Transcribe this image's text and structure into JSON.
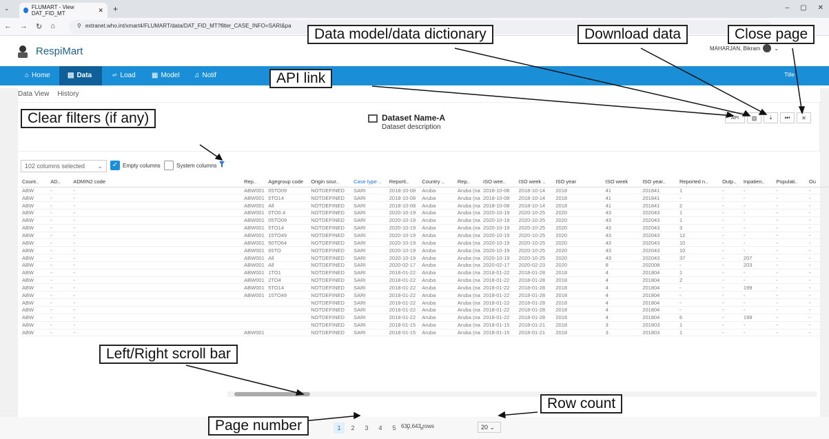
{
  "browser": {
    "tab_title": "FLUMART - View DAT_FID_MT",
    "url": "extranet.who.int/xmart4/FLUMART/data/DAT_FID_MT?filter_CASE_INFO=SARI&pa"
  },
  "app": {
    "name": "RespiMart",
    "user": "MAHARJAN, Bikram",
    "nav": [
      "Home",
      "Data",
      "Load",
      "Model",
      "Notif"
    ],
    "title_label": "Title",
    "sub_tabs": [
      "Data View",
      "History"
    ]
  },
  "dataset": {
    "name": "Dataset Name-A",
    "description": "Dataset description"
  },
  "toolbar": {
    "api": "API"
  },
  "filters": {
    "columns_selected": "102 columns selected",
    "empty_columns": "Empty columns",
    "system_columns": "System columns"
  },
  "table": {
    "headers": [
      "Count..",
      "AD..",
      "ADMIN2 code",
      "Rep..",
      "Agegroup code",
      "Origin sour..",
      "Case type ..",
      "Reporti..",
      "Country ..",
      "Rep..",
      "ISO wee..",
      "ISO week ..",
      "ISO year",
      "ISO week",
      "ISO year..",
      "Reported n..",
      "Outp..",
      "Inpatien..",
      "Populati..",
      "Ou"
    ],
    "rows": [
      [
        "ABW",
        "-",
        "-",
        "ABW001",
        "05TO09",
        "NOTDEFINED",
        "SARI",
        "2018-10-08",
        "Aruba",
        "Aruba (na",
        "2018-10-08",
        "2018-10-14",
        "2018",
        "41",
        "201841",
        "1",
        "-",
        "-",
        "-",
        "-"
      ],
      [
        "ABW",
        "-",
        "-",
        "ABW001",
        "5TO14",
        "NOTDEFINED",
        "SARI",
        "2018-10-08",
        "Aruba",
        "Aruba (na",
        "2018-10-08",
        "2018-10-14",
        "2018",
        "41",
        "201841",
        "-",
        "-",
        "-",
        "-",
        "-"
      ],
      [
        "ABW",
        "-",
        "-",
        "ABW001",
        "All",
        "NOTDEFINED",
        "SARI",
        "2018-10-08",
        "Aruba",
        "Aruba (na",
        "2018-10-08",
        "2018-10-14",
        "2018",
        "41",
        "201841",
        "2",
        "-",
        "-",
        "-",
        "-"
      ],
      [
        "ABW",
        "-",
        "-",
        "ABW001",
        "0TO0.4",
        "NOTDEFINED",
        "SARI",
        "2020-10-19",
        "Aruba",
        "Aruba (na",
        "2020-10-19",
        "2020-10-25",
        "2020",
        "43",
        "202043",
        "1",
        "-",
        "-",
        "-",
        "-"
      ],
      [
        "ABW",
        "-",
        "-",
        "ABW001",
        "05TO09",
        "NOTDEFINED",
        "SARI",
        "2020-10-19",
        "Aruba",
        "Aruba (na",
        "2020-10-19",
        "2020-10-25",
        "2020",
        "43",
        "202043",
        "1",
        "-",
        "-",
        "-",
        "-"
      ],
      [
        "ABW",
        "-",
        "-",
        "ABW001",
        "5TO14",
        "NOTDEFINED",
        "SARI",
        "2020-10-19",
        "Aruba",
        "Aruba (na",
        "2020-10-19",
        "2020-10-25",
        "2020",
        "43",
        "202043",
        "3",
        "-",
        "-",
        "-",
        "-"
      ],
      [
        "ABW",
        "-",
        "-",
        "ABW001",
        "15TO49",
        "NOTDEFINED",
        "SARI",
        "2020-10-19",
        "Aruba",
        "Aruba (na",
        "2020-10-19",
        "2020-10-25",
        "2020",
        "43",
        "202043",
        "12",
        "-",
        "-",
        "-",
        "-"
      ],
      [
        "ABW",
        "-",
        "-",
        "ABW001",
        "50TO64",
        "NOTDEFINED",
        "SARI",
        "2020-10-19",
        "Aruba",
        "Aruba (na",
        "2020-10-19",
        "2020-10-25",
        "2020",
        "43",
        "202043",
        "10",
        "-",
        "-",
        "-",
        "-"
      ],
      [
        "ABW",
        "-",
        "-",
        "ABW001",
        "65TO",
        "NOTDEFINED",
        "SARI",
        "2020-10-19",
        "Aruba",
        "Aruba (na",
        "2020-10-19",
        "2020-10-25",
        "2020",
        "43",
        "202043",
        "10",
        "-",
        "-",
        "-",
        "-"
      ],
      [
        "ABW",
        "-",
        "-",
        "ABW001",
        "All",
        "NOTDEFINED",
        "SARI",
        "2020-10-19",
        "Aruba",
        "Aruba (na",
        "2020-10-19",
        "2020-10-25",
        "2020",
        "43",
        "202043",
        "37",
        "-",
        "207",
        "-",
        "-"
      ],
      [
        "ABW",
        "-",
        "-",
        "ABW001",
        "All",
        "NOTDEFINED",
        "SARI",
        "2020-02-17",
        "Aruba",
        "Aruba (na",
        "2020-02-17",
        "2020-02-23",
        "2020",
        "8",
        "202008",
        "-",
        "-",
        "203",
        "-",
        "-"
      ],
      [
        "ABW",
        "-",
        "-",
        "ABW001",
        "1TO1",
        "NOTDEFINED",
        "SARI",
        "2018-01-22",
        "Aruba",
        "Aruba (na",
        "2018-01-22",
        "2018-01-28",
        "2018",
        "4",
        "201804",
        "1",
        "-",
        "-",
        "-",
        "-"
      ],
      [
        "ABW",
        "-",
        "-",
        "ABW001",
        "2TO4",
        "NOTDEFINED",
        "SARI",
        "2018-01-22",
        "Aruba",
        "Aruba (na",
        "2018-01-22",
        "2018-01-28",
        "2018",
        "4",
        "201804",
        "2",
        "-",
        "-",
        "-",
        "-"
      ],
      [
        "ABW",
        "-",
        "-",
        "ABW001",
        "5TO14",
        "NOTDEFINED",
        "SARI",
        "2018-01-22",
        "Aruba",
        "Aruba (na",
        "2018-01-22",
        "2018-01-28",
        "2018",
        "4",
        "201804",
        "-",
        "-",
        "199",
        "-",
        "-"
      ],
      [
        "ABW",
        "-",
        "-",
        "ABW001",
        "15TO49",
        "NOTDEFINED",
        "SARI",
        "2018-01-22",
        "Aruba",
        "Aruba (na",
        "2018-01-22",
        "2018-01-28",
        "2018",
        "4",
        "201804",
        "-",
        "-",
        "-",
        "-",
        "-"
      ],
      [
        "ABW",
        "-",
        "-",
        "",
        "",
        "NOTDEFINED",
        "SARI",
        "2018-01-22",
        "Aruba",
        "Aruba (na",
        "2018-01-22",
        "2018-01-28",
        "2018",
        "4",
        "201804",
        "-",
        "-",
        "-",
        "-",
        "-"
      ],
      [
        "ABW",
        "-",
        "-",
        "",
        "",
        "NOTDEFINED",
        "SARI",
        "2018-01-22",
        "Aruba",
        "Aruba (na",
        "2018-01-22",
        "2018-01-28",
        "2018",
        "4",
        "201804",
        "-",
        "-",
        "-",
        "-",
        "-"
      ],
      [
        "ABW",
        "-",
        "-",
        "",
        "",
        "NOTDEFINED",
        "SARI",
        "2018-01-22",
        "Aruba",
        "Aruba (na",
        "2018-01-22",
        "2018-01-28",
        "2018",
        "4",
        "201804",
        "6",
        "-",
        "199",
        "-",
        "-"
      ],
      [
        "ABW",
        "-",
        "-",
        "",
        "",
        "NOTDEFINED",
        "SARI",
        "2018-01-15",
        "Aruba",
        "Aruba (na",
        "2018-01-15",
        "2018-01-21",
        "2018",
        "3",
        "201803",
        "1",
        "-",
        "-",
        "-",
        "-"
      ],
      [
        "ABW",
        "-",
        "-",
        "ABW001",
        "",
        "NOTDEFINED",
        "SARI",
        "2018-01-15",
        "Aruba",
        "Aruba (na",
        "2018-01-15",
        "2018-01-21",
        "2018",
        "3",
        "201803",
        "1",
        "-",
        "-",
        "-",
        "-"
      ]
    ]
  },
  "pagination": {
    "pages": [
      "1",
      "2",
      "3",
      "4",
      "5",
      "›",
      "»"
    ],
    "active": "1",
    "row_count": "20",
    "total_rows": "630,643 rows"
  },
  "callouts": {
    "data_model": "Data model/data dictionary",
    "download": "Download data",
    "close": "Close page",
    "api": "API link",
    "clear_filters": "Clear filters (if any)",
    "scroll": "Left/Right scroll bar",
    "row_count": "Row count",
    "page_number": "Page number"
  },
  "colors": {
    "nav_blue": "#1a8fd8",
    "nav_active": "#0e5f9a",
    "brand": "#1f5f8b"
  },
  "icons": [
    "home-icon",
    "database-icon",
    "filter-load-icon",
    "model-icon",
    "bell-icon",
    "table-icon",
    "book-icon",
    "download-icon",
    "close-icon",
    "filter-clear-icon"
  ]
}
